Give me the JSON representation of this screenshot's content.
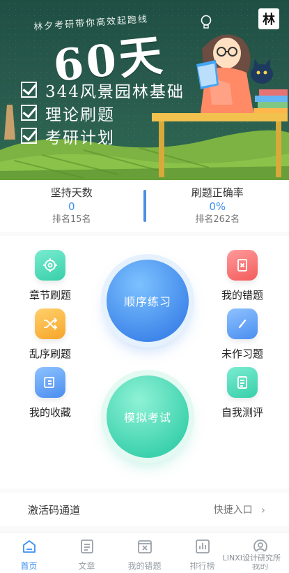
{
  "banner": {
    "tagline": "林夕考研带你高效起跑线",
    "big_text": "60天",
    "checklist": [
      "344风景园林基础",
      "理论刷题",
      "考研计划"
    ],
    "logo_text": "林"
  },
  "stats": {
    "days": {
      "label": "坚持天数",
      "value": "0",
      "rank": "排名15名"
    },
    "accuracy": {
      "label": "刷题正确率",
      "value": "0%",
      "rank": "排名262名"
    }
  },
  "grid": {
    "chapter": "章节刷题",
    "wrong": "我的错题",
    "random": "乱序刷题",
    "undone": "未作习题",
    "favorites": "我的收藏",
    "self_test": "自我测评",
    "sequence": "顺序练习",
    "mock_exam": "模拟考试"
  },
  "activation": {
    "title": "激活码通道",
    "hint": "快捷入口",
    "chevron": "›"
  },
  "tabs": [
    {
      "label": "首页",
      "icon": "home-icon",
      "active": true
    },
    {
      "label": "文章",
      "icon": "article-icon"
    },
    {
      "label": "我的错题",
      "icon": "wrong-icon"
    },
    {
      "label": "排行榜",
      "icon": "ranking-icon"
    },
    {
      "label": "我的",
      "icon": "profile-icon"
    }
  ],
  "watermark": "LINXI设计研究所",
  "colors": {
    "accent": "#3b8ff0",
    "green": "#3bd1ac",
    "red": "#f45c5c",
    "orange": "#f7a52a"
  }
}
